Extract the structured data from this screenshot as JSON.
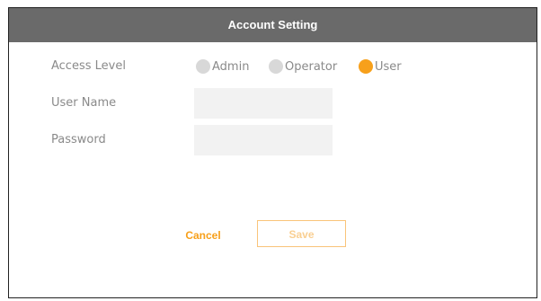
{
  "dialog": {
    "title": "Account Setting"
  },
  "form": {
    "access_level_label": "Access Level",
    "user_name_label": "User Name",
    "password_label": "Password",
    "user_name_value": "",
    "password_value": "",
    "access_options": [
      {
        "label": "Admin",
        "selected": false
      },
      {
        "label": "Operator",
        "selected": false
      },
      {
        "label": "User",
        "selected": true
      }
    ]
  },
  "actions": {
    "cancel_label": "Cancel",
    "save_label": "Save"
  },
  "colors": {
    "accent": "#f7a01b",
    "titlebar": "#6a6a6a",
    "radio_unselected": "#d8d8d8",
    "field_background": "#f2f2f2"
  }
}
